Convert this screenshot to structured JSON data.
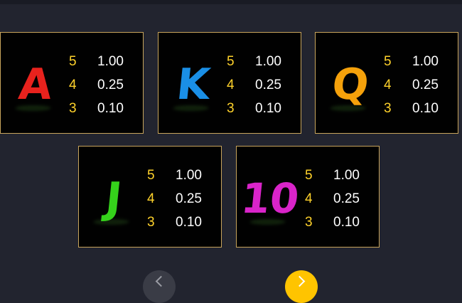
{
  "paytable": {
    "symbols": [
      {
        "id": "a",
        "label": "A",
        "icon": "letter-a-symbol",
        "color": "#e8221d",
        "pays": [
          {
            "count": "5",
            "value": "1.00"
          },
          {
            "count": "4",
            "value": "0.25"
          },
          {
            "count": "3",
            "value": "0.10"
          }
        ]
      },
      {
        "id": "k",
        "label": "K",
        "icon": "letter-k-symbol",
        "color": "#1a8fe6",
        "pays": [
          {
            "count": "5",
            "value": "1.00"
          },
          {
            "count": "4",
            "value": "0.25"
          },
          {
            "count": "3",
            "value": "0.10"
          }
        ]
      },
      {
        "id": "q",
        "label": "Q",
        "icon": "letter-q-symbol",
        "color": "#f5a10b",
        "pays": [
          {
            "count": "5",
            "value": "1.00"
          },
          {
            "count": "4",
            "value": "0.25"
          },
          {
            "count": "3",
            "value": "0.10"
          }
        ]
      },
      {
        "id": "j",
        "label": "J",
        "icon": "letter-j-symbol",
        "color": "#35d11b",
        "pays": [
          {
            "count": "5",
            "value": "1.00"
          },
          {
            "count": "4",
            "value": "0.25"
          },
          {
            "count": "3",
            "value": "0.10"
          }
        ]
      },
      {
        "id": "ten",
        "label": "10",
        "icon": "number-10-symbol",
        "color": "#d924c9",
        "pays": [
          {
            "count": "5",
            "value": "1.00"
          },
          {
            "count": "4",
            "value": "0.25"
          },
          {
            "count": "3",
            "value": "0.10"
          }
        ]
      }
    ]
  },
  "navigation": {
    "prev_icon": "chevron-left-icon",
    "next_icon": "chevron-right-icon",
    "prev_color": "#3a3c46",
    "next_color": "#ffc400"
  },
  "colors": {
    "background": "#22242f",
    "card_border": "#c9a55c",
    "count_color": "#ffd22b",
    "value_color": "#ffffff"
  }
}
